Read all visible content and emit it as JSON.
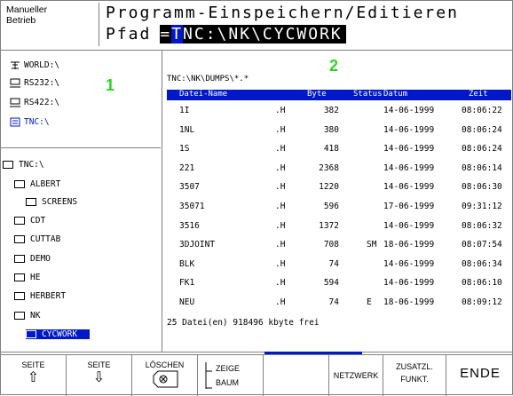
{
  "header": {
    "mode": "Manueller\nBetrieb",
    "title": "Programm-Einspeichern/Editieren",
    "path_label": "Pfad",
    "path_prefix": "=",
    "path_cursor": "T",
    "path_value": "NC:\\NK\\CYCWORK"
  },
  "markers": {
    "left": "1",
    "right": "2"
  },
  "drives": [
    {
      "label": "WORLD:\\",
      "icon": "network-icon"
    },
    {
      "label": "RS232:\\",
      "icon": "serial-port-icon"
    },
    {
      "label": "RS422:\\",
      "icon": "serial-port-icon"
    },
    {
      "label": "TNC:\\",
      "icon": "drive-icon"
    }
  ],
  "tree": [
    {
      "label": "TNC:\\"
    },
    {
      "label": "ALBERT"
    },
    {
      "label": "SCREENS"
    },
    {
      "label": "CDT"
    },
    {
      "label": "CUTTAB"
    },
    {
      "label": "DEMO"
    },
    {
      "label": "HE"
    },
    {
      "label": "HERBERT"
    },
    {
      "label": "NK"
    },
    {
      "label": "CYCWORK"
    }
  ],
  "filelist": {
    "path": "TNC:\\NK\\DUMPS\\*.*",
    "columns": {
      "name": "Datei-Name",
      "byte": "Byte",
      "status": "Status",
      "date": "Datum",
      "time": "Zeit"
    },
    "rows": [
      {
        "name": "1I",
        "ext": ".H",
        "byte": "382",
        "status": "",
        "date": "14-06-1999",
        "time": "08:06:22"
      },
      {
        "name": "1NL",
        "ext": ".H",
        "byte": "380",
        "status": "",
        "date": "14-06-1999",
        "time": "08:06:24"
      },
      {
        "name": "1S",
        "ext": ".H",
        "byte": "418",
        "status": "",
        "date": "14-06-1999",
        "time": "08:06:24"
      },
      {
        "name": "221",
        "ext": ".H",
        "byte": "2368",
        "status": "",
        "date": "14-06-1999",
        "time": "08:06:14"
      },
      {
        "name": "3507",
        "ext": ".H",
        "byte": "1220",
        "status": "",
        "date": "14-06-1999",
        "time": "08:06:30"
      },
      {
        "name": "35071",
        "ext": ".H",
        "byte": "596",
        "status": "",
        "date": "17-06-1999",
        "time": "09:31:12"
      },
      {
        "name": "3516",
        "ext": ".H",
        "byte": "1372",
        "status": "",
        "date": "14-06-1999",
        "time": "08:06:32"
      },
      {
        "name": "3DJOINT",
        "ext": ".H",
        "byte": "708",
        "status": "SM",
        "date": "18-06-1999",
        "time": "08:07:54"
      },
      {
        "name": "BLK",
        "ext": ".H",
        "byte": "74",
        "status": "",
        "date": "14-06-1999",
        "time": "08:06:34"
      },
      {
        "name": "FK1",
        "ext": ".H",
        "byte": "594",
        "status": "",
        "date": "14-06-1999",
        "time": "08:06:10"
      },
      {
        "name": "NEU",
        "ext": ".H",
        "byte": "74",
        "status": "E",
        "date": "18-06-1999",
        "time": "08:09:12"
      }
    ],
    "footer": "25  Datei(en) 918496 kbyte frei"
  },
  "softkeys": [
    {
      "line1": "SEITE",
      "line2": "⇧"
    },
    {
      "line1": "SEITE",
      "line2": "⇩"
    },
    {
      "line1": "LÖSCHEN",
      "line2": ""
    },
    {
      "line1": "ZEIGE",
      "line2": "BAUM"
    },
    {
      "line1": "",
      "line2": ""
    },
    {
      "line1": "NETZWERK",
      "line2": ""
    },
    {
      "line1": "ZUSATZL.",
      "line2": "FUNKT."
    },
    {
      "line1": "ENDE",
      "line2": ""
    }
  ]
}
